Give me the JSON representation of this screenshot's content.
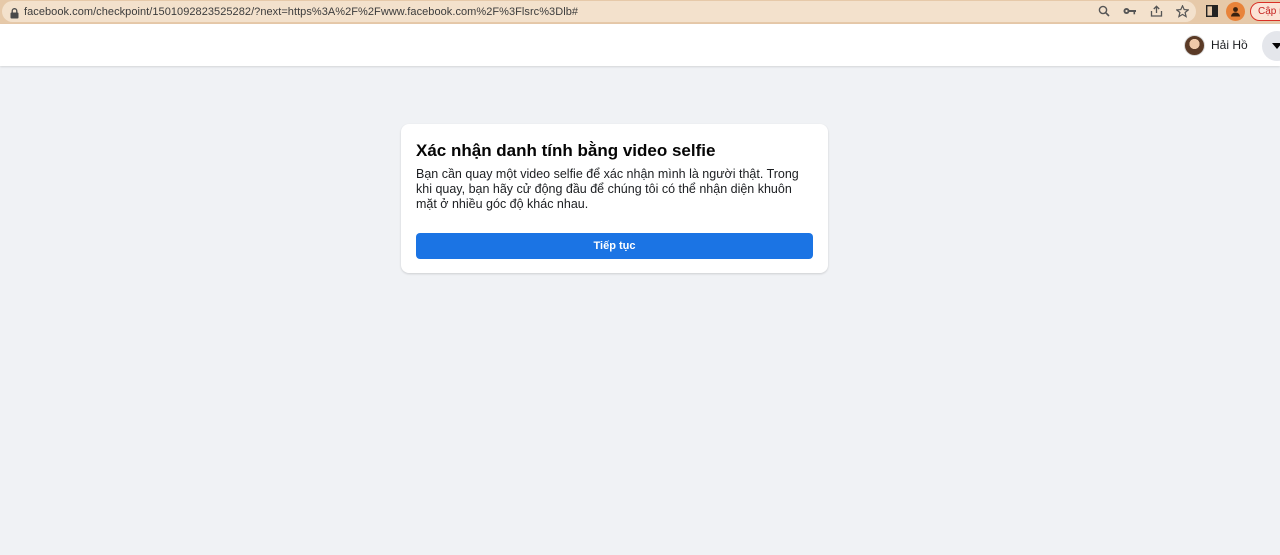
{
  "browser": {
    "url": "facebook.com/checkpoint/1501092823525282/?next=https%3A%2F%2Fwww.facebook.com%2F%3Flsrc%3Dlb#",
    "update_label": "Cập n",
    "icons": [
      "lock-icon",
      "zoom-icon",
      "key-icon",
      "share-icon",
      "bookmark-star-icon",
      "side-panel-icon",
      "profile-icon"
    ]
  },
  "header": {
    "user_name": "Hải Hồ"
  },
  "card": {
    "title": "Xác nhận danh tính bằng video selfie",
    "description": "Bạn cần quay một video selfie để xác nhận mình là người thật. Trong khi quay, bạn hãy cử động đầu để chúng tôi có thể nhận diện khuôn mặt ở nhiều góc độ khác nhau.",
    "button_label": "Tiếp tục"
  },
  "colors": {
    "page_background": "#f0f2f5",
    "primary_button": "#1b74e4",
    "browser_bar": "#e6c9a9"
  }
}
